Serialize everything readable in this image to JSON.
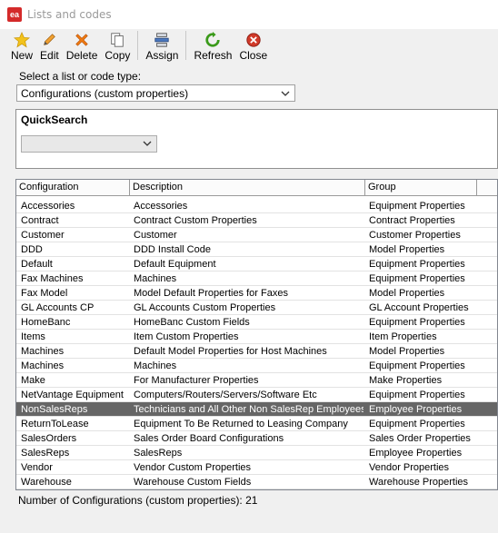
{
  "window": {
    "title": "Lists and codes",
    "app_icon_text": "ea"
  },
  "toolbar": {
    "buttons": [
      {
        "label": "New",
        "icon": "star-icon"
      },
      {
        "label": "Edit",
        "icon": "pencil-icon"
      },
      {
        "label": "Delete",
        "icon": "delete-x-icon"
      },
      {
        "label": "Copy",
        "icon": "copy-icon"
      },
      {
        "label": "Assign",
        "icon": "assign-icon"
      },
      {
        "label": "Refresh",
        "icon": "refresh-icon"
      },
      {
        "label": "Close",
        "icon": "close-icon"
      }
    ]
  },
  "type_selector": {
    "label": "Select a list or code type:",
    "value": "Configurations (custom properties)"
  },
  "quick_search": {
    "label": "QuickSearch",
    "value": ""
  },
  "grid": {
    "columns": [
      "Configuration",
      "Description",
      "Group"
    ],
    "rows": [
      [
        "Accessories",
        "Accessories",
        "Equipment Properties"
      ],
      [
        "Contract",
        "Contract Custom Properties",
        "Contract Properties"
      ],
      [
        "Customer",
        "Customer",
        "Customer Properties"
      ],
      [
        "DDD",
        "DDD Install Code",
        "Model Properties"
      ],
      [
        "Default",
        "Default Equipment",
        "Equipment Properties"
      ],
      [
        "Fax Machines",
        "Machines",
        "Equipment Properties"
      ],
      [
        "Fax Model",
        "Model Default Properties for Faxes",
        "Model Properties"
      ],
      [
        "GL Accounts CP",
        "GL Accounts Custom Properties",
        "GL Account Properties"
      ],
      [
        "HomeBanc",
        "HomeBanc Custom Fields",
        "Equipment Properties"
      ],
      [
        "Items",
        "Item Custom Properties",
        "Item Properties"
      ],
      [
        "Machines",
        "Default Model Properties for Host Machines",
        "Model Properties"
      ],
      [
        "Machines",
        "Machines",
        "Equipment Properties"
      ],
      [
        "Make",
        "For Manufacturer Properties",
        "Make Properties"
      ],
      [
        "NetVantage Equipment",
        "Computers/Routers/Servers/Software Etc",
        "Equipment Properties"
      ],
      [
        "NonSalesReps",
        "Technicians and All Other Non SalesRep Employees",
        "Employee Properties"
      ],
      [
        "ReturnToLease",
        "Equipment To Be Returned to Leasing Company",
        "Equipment Properties"
      ],
      [
        "SalesOrders",
        "Sales Order Board Configurations",
        "Sales Order Properties"
      ],
      [
        "SalesReps",
        "SalesReps",
        "Employee Properties"
      ],
      [
        "Vendor",
        "Vendor Custom Properties",
        "Vendor Properties"
      ],
      [
        "Warehouse",
        "Warehouse Custom Fields",
        "Warehouse Properties"
      ]
    ],
    "selected_index": 14
  },
  "status": {
    "text": "Number of Configurations (custom properties): 21"
  },
  "colors": {
    "selected_row": "#666666",
    "app_icon": "#d42a2a"
  }
}
